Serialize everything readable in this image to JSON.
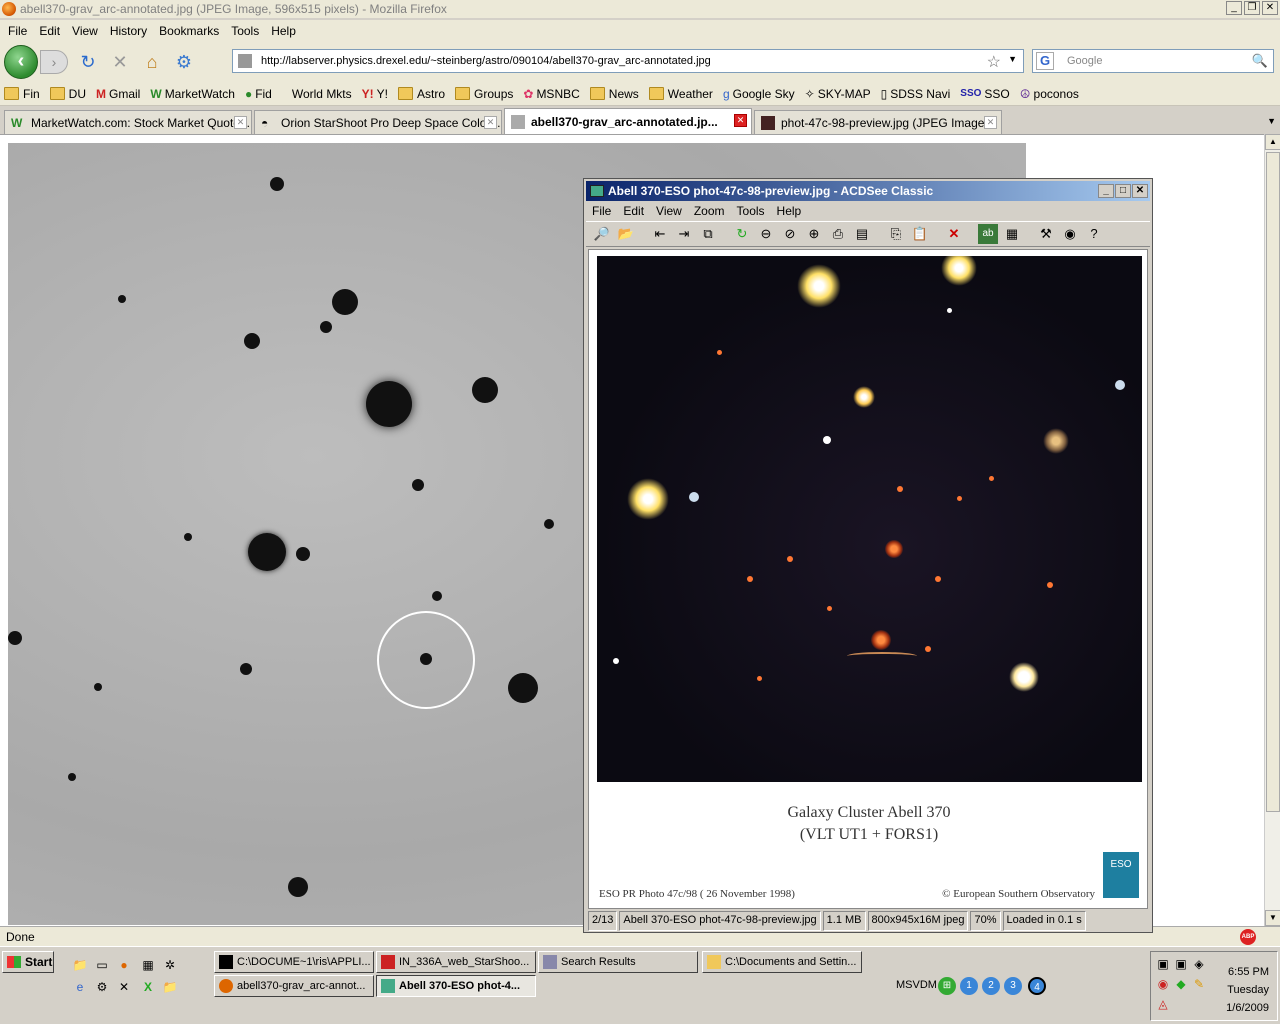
{
  "firefox": {
    "title": "abell370-grav_arc-annotated.jpg (JPEG Image, 596x515 pixels) - Mozilla Firefox",
    "menu": [
      "File",
      "Edit",
      "View",
      "History",
      "Bookmarks",
      "Tools",
      "Help"
    ],
    "url": "http://labserver.physics.drexel.edu/~steinberg/astro/090104/abell370-grav_arc-annotated.jpg",
    "search_placeholder": "Google",
    "bookmarks": [
      "Fin",
      "DU",
      "Gmail",
      "MarketWatch",
      "Fid",
      "World Mkts",
      "Y!",
      "Astro",
      "Groups",
      "MSNBC",
      "News",
      "Weather",
      "Google Sky",
      "SKY-MAP",
      "SDSS Navi",
      "SSO",
      "poconos"
    ],
    "tabs": [
      {
        "label": "MarketWatch.com: Stock Market Quote..."
      },
      {
        "label": "Orion StarShoot Pro Deep Space Color ..."
      },
      {
        "label": "abell370-grav_arc-annotated.jp..."
      },
      {
        "label": "phot-47c-98-preview.jpg (JPEG Image,..."
      }
    ],
    "status": "Done"
  },
  "acdsee": {
    "title": "Abell 370-ESO phot-47c-98-preview.jpg - ACDSee Classic",
    "menu": [
      "File",
      "Edit",
      "View",
      "Zoom",
      "Tools",
      "Help"
    ],
    "caption_line1": "Galaxy Cluster Abell 370",
    "caption_line2": "(VLT UT1 + FORS1)",
    "credit_left": "ESO PR Photo 47c/98 ( 26 November 1998)",
    "credit_right": "© European Southern Observatory",
    "logo_text": "ESO",
    "status": {
      "index": "2/13",
      "file": "Abell 370-ESO phot-47c-98-preview.jpg",
      "size": "1.1 MB",
      "dims": "800x945x16M jpeg",
      "zoom": "70%",
      "load": "Loaded in 0.1 s"
    }
  },
  "taskbar": {
    "start": "Start",
    "buttons": [
      {
        "label": "C:\\DOCUME~1\\ris\\APPLI..."
      },
      {
        "label": "IN_336A_web_StarShoo..."
      },
      {
        "label": "Search Results"
      },
      {
        "label": "C:\\Documents and Settin..."
      },
      {
        "label": "abell370-grav_arc-annot..."
      },
      {
        "label": "Abell 370-ESO phot-4..."
      }
    ],
    "msvdm": "MSVDM",
    "desktops": [
      "1",
      "2",
      "3",
      "4"
    ],
    "time": "6:55 PM",
    "day": "Tuesday",
    "date": "1/6/2009"
  }
}
